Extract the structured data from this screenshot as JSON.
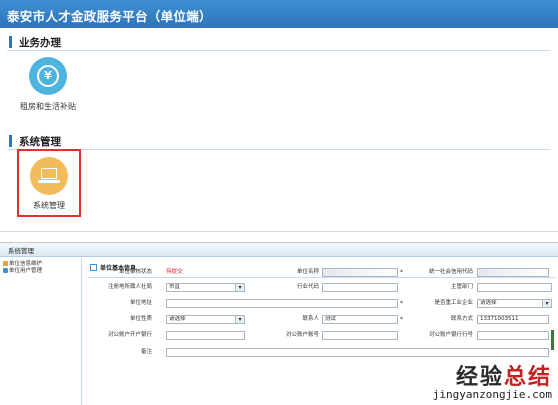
{
  "header": {
    "title": "泰安市人才金政服务平台（单位端）"
  },
  "sections": {
    "business": {
      "title": "业务办理",
      "tiles": [
        {
          "label": "租房和生活补贴",
          "icon": "yen-coin-icon"
        }
      ]
    },
    "system": {
      "title": "系统管理",
      "tiles": [
        {
          "label": "系统管理",
          "icon": "laptop-icon"
        }
      ]
    }
  },
  "admin": {
    "tab_label": "系统管理",
    "tree": [
      "单位信息维护",
      "单位用户管理"
    ],
    "form_title": "单位基本信息",
    "fields": {
      "audit_status": {
        "label": "单位审核状态",
        "value": "待提交"
      },
      "unit_name": {
        "label": "单位名称",
        "value": ""
      },
      "credit_code": {
        "label": "统一社会信用代码",
        "value": ""
      },
      "reg_place": {
        "label": "注册地所属人社局",
        "value": "市直"
      },
      "industry_code": {
        "label": "行业代码",
        "value": ""
      },
      "supervisor": {
        "label": "主管部门",
        "value": ""
      },
      "address": {
        "label": "单位地址",
        "value": ""
      },
      "key_industry": {
        "label": "是否重工业企业",
        "value": "请选择"
      },
      "nature": {
        "label": "单位性质",
        "value": "请选择"
      },
      "contact": {
        "label": "联系人",
        "value": "测试"
      },
      "phone": {
        "label": "联系方式",
        "value": "13371003511"
      },
      "bank": {
        "label": "对公账户开户银行",
        "value": ""
      },
      "account": {
        "label": "对公账户账号",
        "value": ""
      },
      "bank_no": {
        "label": "对公账户银行行号",
        "value": ""
      },
      "remark": {
        "label": "备注",
        "value": ""
      }
    }
  },
  "watermark": {
    "cn_main": "经验",
    "cn_accent": "总结",
    "url": "jingyanzongjie.com"
  },
  "colors": {
    "header_blue": "#2c74bd",
    "accent_red": "#e03030",
    "tile_blue": "#4db4e0",
    "tile_orange": "#f2bc5a"
  }
}
